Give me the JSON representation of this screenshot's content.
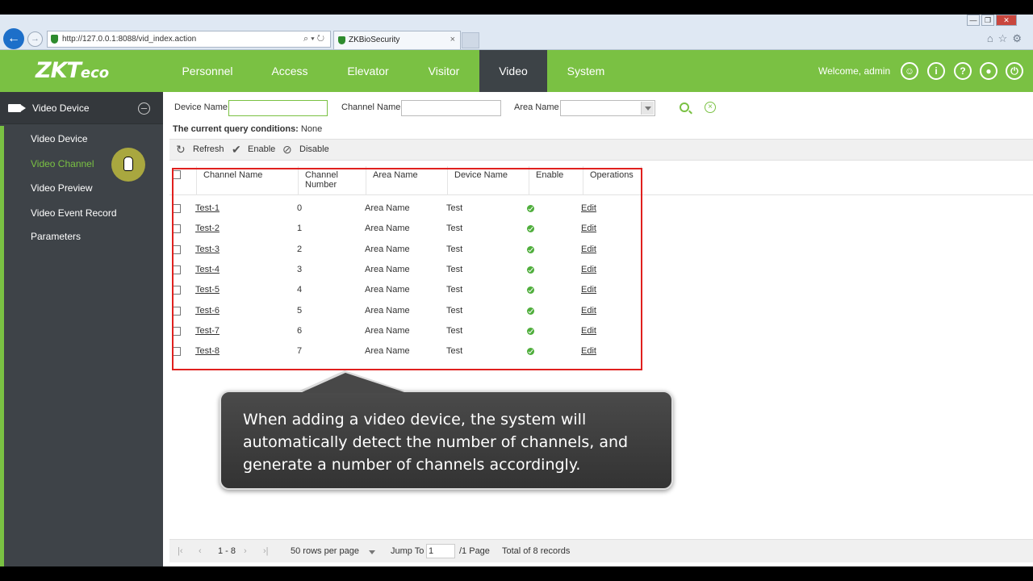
{
  "browser": {
    "url": "http://127.0.0.1:8088/vid_index.action",
    "tab_title": "ZKBioSecurity",
    "tab_close": "×",
    "win_min": "—",
    "win_max": "❐",
    "win_close": "✕"
  },
  "header": {
    "logo": "ZKTeco",
    "nav": [
      "Personnel",
      "Access",
      "Elevator",
      "Visitor",
      "Video",
      "System"
    ],
    "active_nav": "Video",
    "welcome": "Welcome, admin",
    "accent_color": "#7ac143",
    "active_nav_color": "#3d4347"
  },
  "sidebar": {
    "title": "Video Device",
    "items": [
      "Video Device",
      "Video Channel",
      "Video Preview",
      "Video Event Record",
      "Parameters"
    ],
    "active_item": "Video Channel"
  },
  "search": {
    "device_name_label": "Device Name",
    "device_name_value": "",
    "channel_name_label": "Channel Name",
    "channel_name_value": "",
    "area_name_label": "Area Name",
    "area_name_value": ""
  },
  "conditions": {
    "label": "The current query conditions:",
    "value": "None"
  },
  "toolbar": {
    "refresh": "Refresh",
    "enable": "Enable",
    "disable": "Disable"
  },
  "table": {
    "columns": [
      "Channel Name",
      "Channel Number",
      "Area Name",
      "Device Name",
      "Enable",
      "Operations"
    ],
    "rows": [
      {
        "channel_name": "Test-1",
        "channel_number": "0",
        "area_name": "Area Name",
        "device_name": "Test",
        "enabled": true,
        "operation": "Edit"
      },
      {
        "channel_name": "Test-2",
        "channel_number": "1",
        "area_name": "Area Name",
        "device_name": "Test",
        "enabled": true,
        "operation": "Edit"
      },
      {
        "channel_name": "Test-3",
        "channel_number": "2",
        "area_name": "Area Name",
        "device_name": "Test",
        "enabled": true,
        "operation": "Edit"
      },
      {
        "channel_name": "Test-4",
        "channel_number": "3",
        "area_name": "Area Name",
        "device_name": "Test",
        "enabled": true,
        "operation": "Edit"
      },
      {
        "channel_name": "Test-5",
        "channel_number": "4",
        "area_name": "Area Name",
        "device_name": "Test",
        "enabled": true,
        "operation": "Edit"
      },
      {
        "channel_name": "Test-6",
        "channel_number": "5",
        "area_name": "Area Name",
        "device_name": "Test",
        "enabled": true,
        "operation": "Edit"
      },
      {
        "channel_name": "Test-7",
        "channel_number": "6",
        "area_name": "Area Name",
        "device_name": "Test",
        "enabled": true,
        "operation": "Edit"
      },
      {
        "channel_name": "Test-8",
        "channel_number": "7",
        "area_name": "Area Name",
        "device_name": "Test",
        "enabled": true,
        "operation": "Edit"
      }
    ]
  },
  "callout": {
    "text": "When adding a video device, the system will automatically detect the number of channels, and generate a number of channels accordingly."
  },
  "pager": {
    "range": "1 - 8",
    "rows_per_page": "50 rows per page",
    "jump_label": "Jump To",
    "jump_value": "1",
    "page_total": "/1 Page",
    "records": "Total of 8 records"
  }
}
